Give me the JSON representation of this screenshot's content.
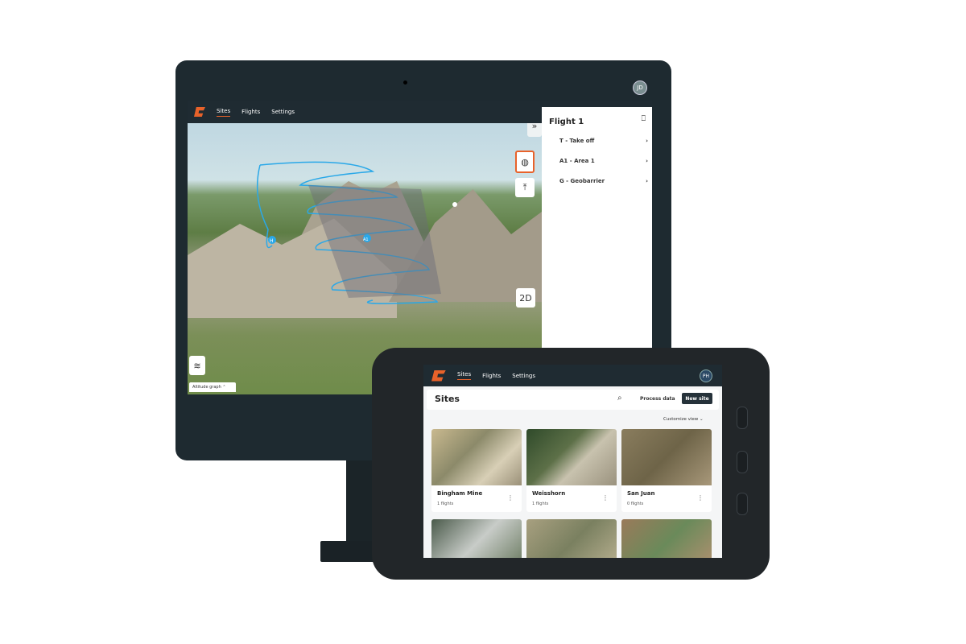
{
  "desktop": {
    "nav": [
      "Sites",
      "Flights",
      "Settings"
    ],
    "avatar": "JD",
    "panel": {
      "title": "Flight 1",
      "items": [
        "T - Take off",
        "A1 - Area 1",
        "G - Geobarrier"
      ]
    },
    "map": {
      "view_toggle": "2D",
      "altitude_graph": "Altitude graph",
      "markers": [
        "H",
        "A1"
      ]
    },
    "icons": [
      "collapse-icon",
      "area-icon",
      "upload-icon",
      "layers-icon",
      "lock-icon"
    ]
  },
  "tablet": {
    "nav": [
      "Sites",
      "Flights",
      "Settings"
    ],
    "avatar": "PH",
    "page_title": "Sites",
    "process_data": "Process data",
    "new_site": "New site",
    "customize_view": "Customize view",
    "sites": [
      {
        "name": "Bingham Mine",
        "flights": "1 flights"
      },
      {
        "name": "Weisshorn",
        "flights": "1 flights"
      },
      {
        "name": "San Juan",
        "flights": "0 flights"
      }
    ]
  },
  "colors": {
    "accent": "#e8622a",
    "navbar": "#1f2b32",
    "check": "#3fb26a",
    "path": "#2aa8e8"
  }
}
